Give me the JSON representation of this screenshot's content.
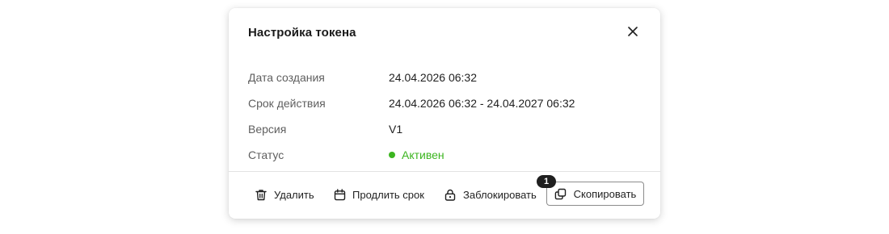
{
  "modal": {
    "title": "Настройка токена",
    "close_icon": "close-icon"
  },
  "info": {
    "created_label": "Дата создания",
    "created_value": "24.04.2026 06:32",
    "validity_label": "Срок действия",
    "validity_value": "24.04.2026 06:32 - 24.04.2027 06:32",
    "version_label": "Версия",
    "version_value": "V1",
    "status_label": "Статус",
    "status_value": "Активен",
    "status_color": "#3cb520"
  },
  "actions": {
    "delete_label": "Удалить",
    "delete_icon": "trash-icon",
    "extend_label": "Продлить срок",
    "extend_icon": "calendar-icon",
    "block_label": "Заблокировать",
    "block_icon": "lock-icon",
    "copy_label": "Скопировать",
    "copy_icon": "copy-icon",
    "copy_badge": "1"
  },
  "colors": {
    "text": "#1f1f1f",
    "label": "#5f5f5f",
    "status_active": "#3cb520",
    "badge_bg": "#1f1f1f",
    "divider": "#e3e3e3"
  }
}
